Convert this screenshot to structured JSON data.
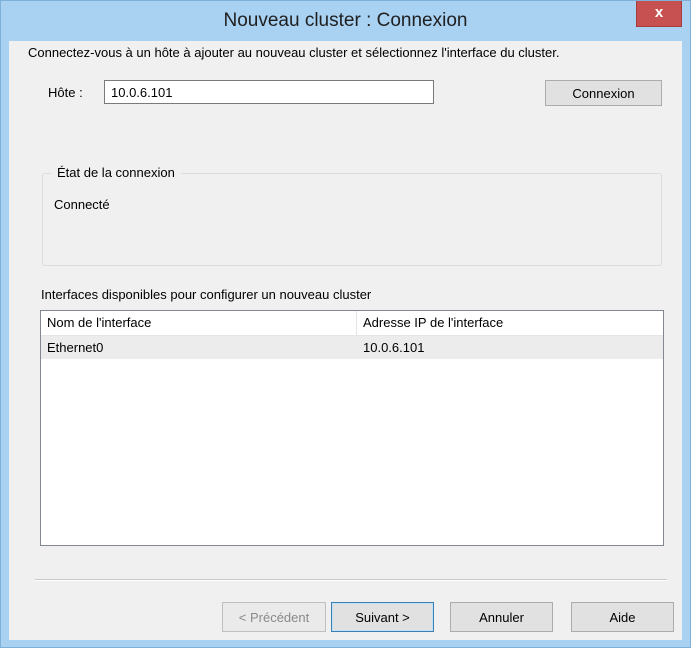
{
  "window": {
    "title": "Nouveau cluster : Connexion",
    "close_label": "x"
  },
  "instruction": "Connectez-vous à un hôte à ajouter au nouveau cluster et sélectionnez l'interface du cluster.",
  "host": {
    "label": "Hôte :",
    "value": "10.0.6.101"
  },
  "connect_button": "Connexion",
  "connection_status": {
    "legend": "État de la connexion",
    "text": "Connecté"
  },
  "interfaces": {
    "label": "Interfaces disponibles pour configurer un nouveau cluster",
    "columns": [
      "Nom de l'interface",
      "Adresse IP de l'interface"
    ],
    "rows": [
      [
        "Ethernet0",
        "10.0.6.101"
      ]
    ]
  },
  "footer": {
    "previous": "< Précédent",
    "next": "Suivant >",
    "cancel": "Annuler",
    "help": "Aide"
  },
  "colors": {
    "titlebar": "#a8d1f2",
    "close_button": "#c75050",
    "dialog_background": "#f0f0f0",
    "selected_row": "#ececec"
  }
}
